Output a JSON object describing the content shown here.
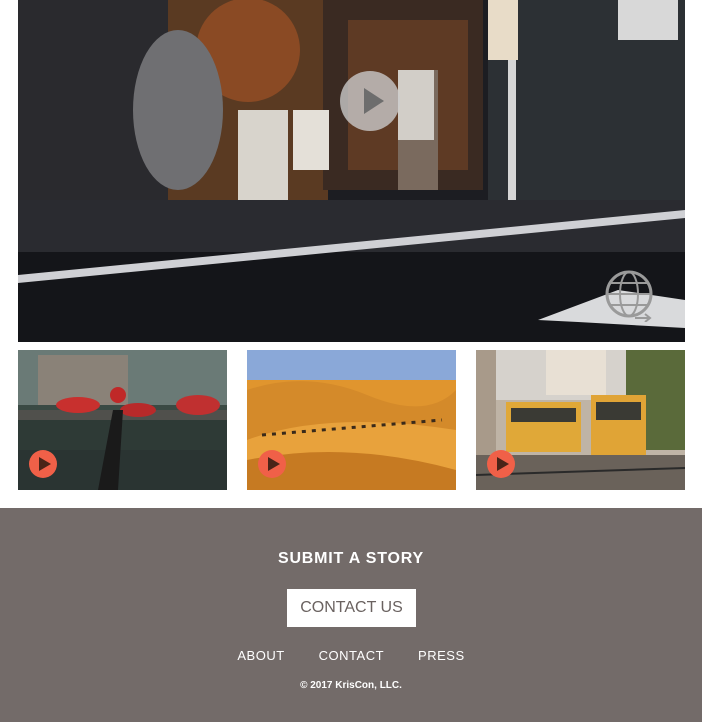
{
  "hero": {
    "media": "street-scene-video",
    "play_icon": "play-icon",
    "overlay_icon": "globe-icon"
  },
  "thumbnails": [
    {
      "scene": "bridge-bicycle-flowers",
      "icon": "play-icon"
    },
    {
      "scene": "desert-camel-caravan",
      "icon": "play-icon"
    },
    {
      "scene": "yellow-trams-street",
      "icon": "play-icon"
    }
  ],
  "colors": {
    "footer_bg": "#736b69",
    "play_accent": "#f06048",
    "button_bg": "#ffffff"
  },
  "footer": {
    "submit_heading": "SUBMIT A STORY",
    "contact_button": "CONTACT US",
    "links": [
      "ABOUT",
      "CONTACT",
      "PRESS"
    ],
    "copyright": "© 2017 KrisCon, LLC."
  }
}
